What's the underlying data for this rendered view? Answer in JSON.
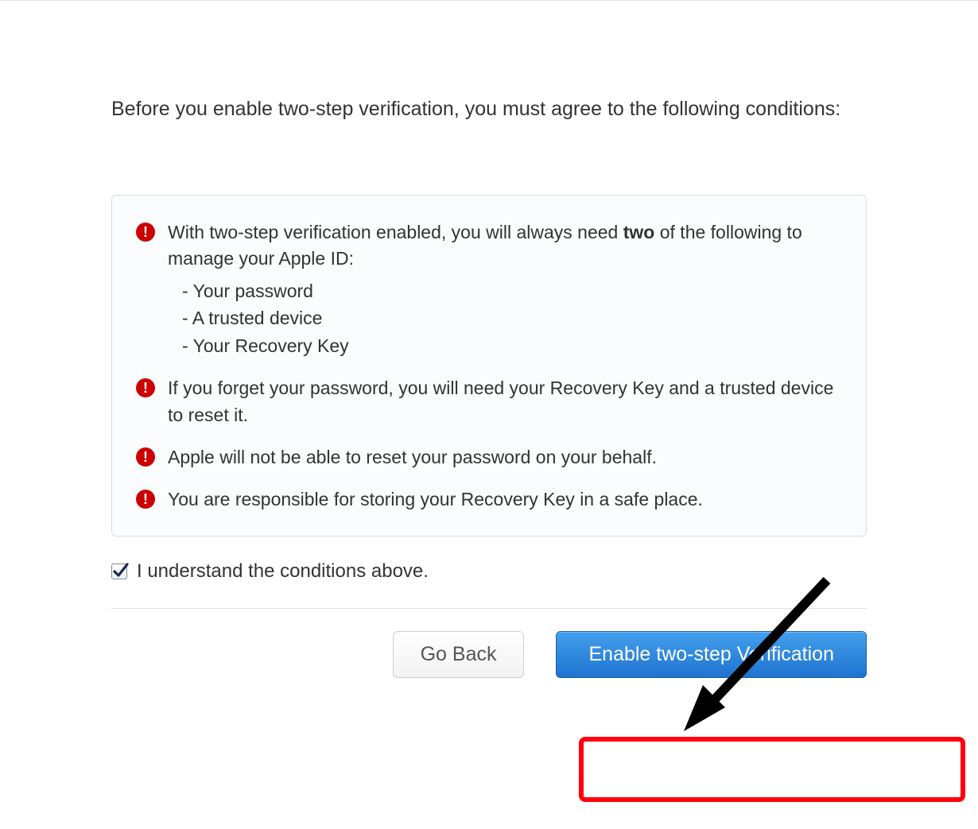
{
  "intro": "Before you enable two-step verification, you must agree to the following conditions:",
  "conditions": [
    {
      "text_prefix": "With two-step verification enabled, you will always need ",
      "bold": "two",
      "text_suffix": " of the following to manage your Apple ID:",
      "sub": [
        "- Your password",
        "- A trusted device",
        "- Your Recovery Key"
      ]
    },
    {
      "text": "If you forget your password, you will need your Recovery Key and a trusted device to reset it."
    },
    {
      "text": "Apple will not be able to reset your password on your behalf."
    },
    {
      "text": "You are responsible for storing your Recovery Key in a safe place."
    }
  ],
  "agree_label": "I understand the conditions above.",
  "buttons": {
    "back": "Go Back",
    "enable": "Enable two-step Verification"
  }
}
